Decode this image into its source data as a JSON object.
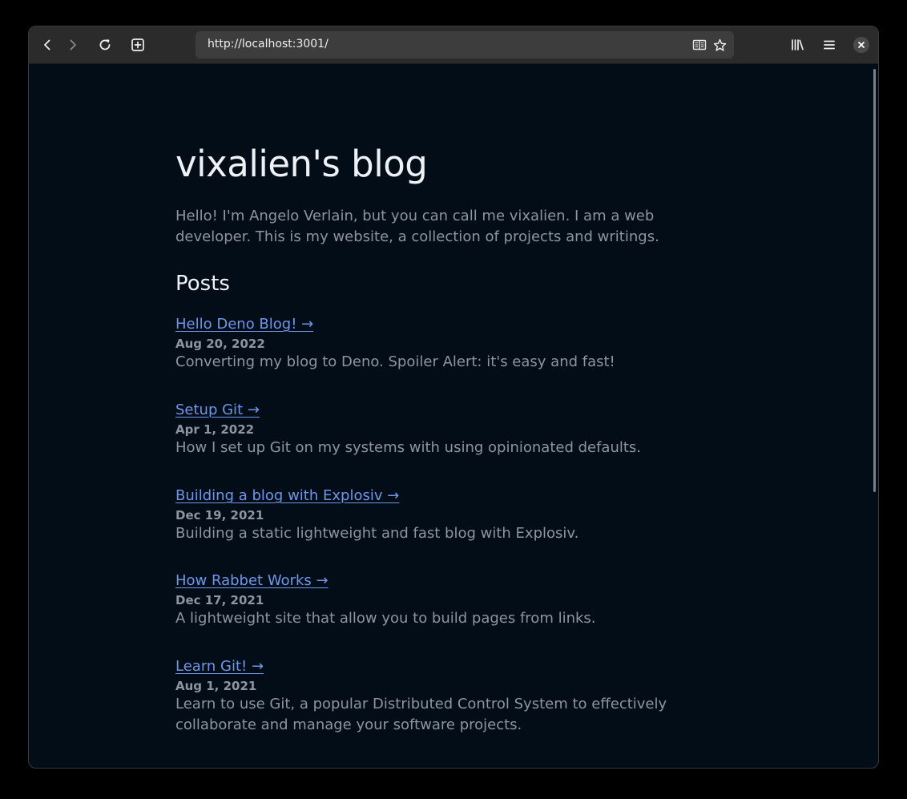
{
  "browser": {
    "url": "http://localhost:3001/",
    "reader_icon": "reader-view-icon",
    "bookmark_icon": "star-icon"
  },
  "blog": {
    "title": "vixalien's blog",
    "intro": "Hello! I'm Angelo Verlain, but you can call me vixalien. I am a web developer. This is my website, a collection of projects and writings.",
    "posts_heading": "Posts",
    "posts": [
      {
        "title": "Hello Deno Blog! →",
        "date": "Aug 20, 2022",
        "snippet": "Converting my blog to Deno. Spoiler Alert: it's easy and fast!"
      },
      {
        "title": "Setup Git →",
        "date": "Apr 1, 2022",
        "snippet": "How I set up Git on my systems with using opinionated defaults."
      },
      {
        "title": "Building a blog with Explosiv →",
        "date": "Dec 19, 2021",
        "snippet": "Building a static lightweight and fast blog with Explosiv."
      },
      {
        "title": "How Rabbet Works →",
        "date": "Dec 17, 2021",
        "snippet": "A lightweight site that allow you to build pages from links."
      },
      {
        "title": "Learn Git! →",
        "date": "Aug 1, 2021",
        "snippet": "Learn to use Git, a popular Distributed Control System to effectively collaborate and manage your software projects."
      }
    ]
  },
  "colors": {
    "page_background": "#020d17",
    "link": "#6f96e8",
    "muted_text": "#8d95a0",
    "heading": "#eef2f6",
    "toolbar": "#2b2b2b"
  }
}
